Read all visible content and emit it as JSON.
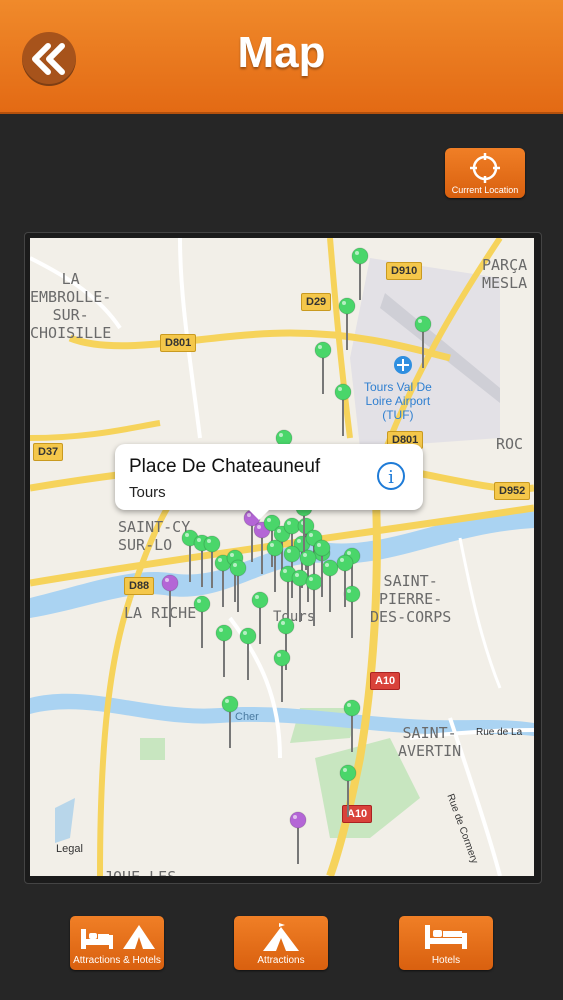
{
  "header": {
    "title": "Map",
    "back_icon": "double-chevron-left-icon"
  },
  "current_location": {
    "label": "Current Location",
    "icon": "crosshair-icon"
  },
  "map": {
    "places": [
      "LA\nEMBROLLE-\nSUR-\nCHOISILLE",
      "PARÇA\nMESLA",
      "SAINT-CY\nSUR-LO",
      "SAINT-\nPIERRE-\nDES-CORPS",
      "LA RICHE",
      "SAINT-\nAVERTIN",
      "Tours Val De\nLoire Airport\n(TUF)",
      "ROC",
      "Cher",
      "Rue de La",
      "Rue de Cormery",
      "Legal",
      "JOUE-LES",
      "Tours"
    ],
    "roads": [
      "D910",
      "D29",
      "D801",
      "D37",
      "D801",
      "D952",
      "D88",
      "A10",
      "A10"
    ]
  },
  "callout": {
    "title": "Place De Chateauneuf",
    "subtitle": "Tours",
    "info_icon": "info-icon"
  },
  "bottom_nav": [
    {
      "label": "Attractions & Hotels",
      "icon": "bed-tent-icon"
    },
    {
      "label": "Attractions",
      "icon": "tent-icon"
    },
    {
      "label": "Hotels",
      "icon": "bed-icon"
    }
  ],
  "colors": {
    "header": "#e8781f",
    "accent": "#e06b16",
    "pin_green": "#4ad66a",
    "pin_purple": "#b466d6"
  }
}
